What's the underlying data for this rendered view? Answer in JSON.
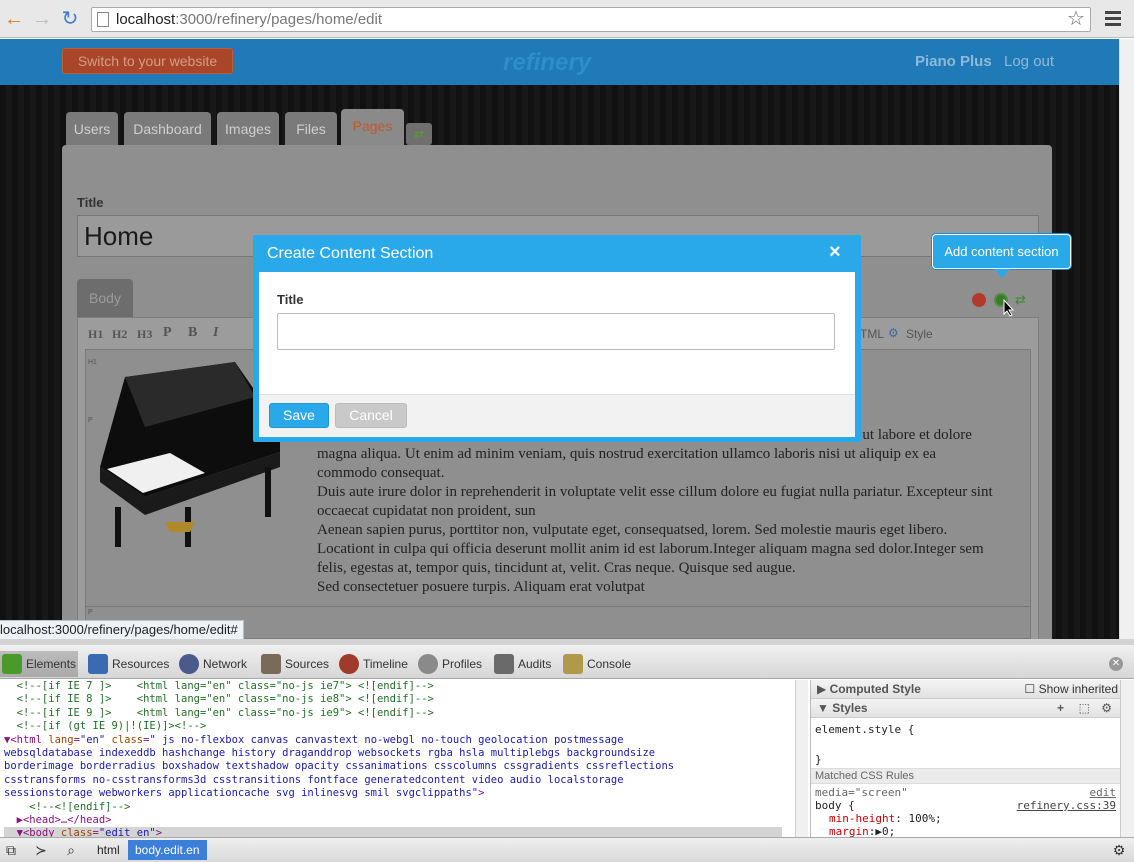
{
  "browser": {
    "url_host": "localhost",
    "url_path": ":3000/refinery/pages/home/edit",
    "status_url": "localhost:3000/refinery/pages/home/edit#"
  },
  "header": {
    "switch_label": "Switch to your website",
    "logo": "refinery",
    "site_name": "Piano Plus",
    "logout": "Log out"
  },
  "tabs": [
    {
      "label": "Users"
    },
    {
      "label": "Dashboard"
    },
    {
      "label": "Images"
    },
    {
      "label": "Files"
    },
    {
      "label": "Pages"
    }
  ],
  "form": {
    "title_label": "Title",
    "title_value": "Home",
    "body_tab": "Body",
    "toolbar": [
      "H1",
      "H2",
      "H3",
      "P",
      "B",
      "I",
      "TML",
      "Style"
    ],
    "editor_markers": [
      "H1",
      "P",
      "P"
    ]
  },
  "content_lines": [
    "dunt ut labore et dolore",
    "magna aliqua. Ut enim ad minim veniam, quis nostrud exercitation ullamco laboris nisi ut aliquip ex ea",
    "commodo consequat.",
    "Duis aute irure dolor in reprehenderit in voluptate velit esse cillum dolore eu fugiat nulla pariatur. Excepteur sint",
    "occaecat cupidatat non proident, sun",
    "Aenean sapien purus, porttitor non, vulputate eget, consequatsed, lorem. Sed molestie mauris eget libero.",
    "Locationt in culpa qui officia deserunt mollit anim id est laborum.Integer aliquam magna sed dolor.Integer sem",
    "felis, egestas at, tempor quis, tincidunt at, velit. Cras neque. Quisque sed augue.",
    "Sed consectetuer posuere turpis. Aliquam erat volutpat"
  ],
  "tooltip": "Add content section",
  "modal": {
    "title": "Create Content Section",
    "close": "×",
    "field_label": "Title",
    "field_value": "",
    "save": "Save",
    "cancel": "Cancel"
  },
  "devtools": {
    "tabs": [
      "Elements",
      "Resources",
      "Network",
      "Sources",
      "Timeline",
      "Profiles",
      "Audits",
      "Console"
    ],
    "computed_style": "Computed Style",
    "show_inherited": "Show inherited",
    "styles": "Styles",
    "element_style": "element.style {",
    "element_style_close": "}",
    "matched_rules": "Matched CSS Rules",
    "media": "media=\"screen\"",
    "edit": "edit",
    "selector": "body {",
    "source": "refinery.css:39",
    "prop1_name": "min-height",
    "prop1_value": "100%;",
    "prop2_name": "margin",
    "prop2_value": "0;",
    "breadcrumbs": [
      "html",
      "body.edit.en"
    ]
  },
  "colors": {
    "accent": "#2aa9ea",
    "header_blue": "#1f7ab7",
    "switch_orange": "#b8411a",
    "selected_crumb": "#3b7fd8"
  }
}
